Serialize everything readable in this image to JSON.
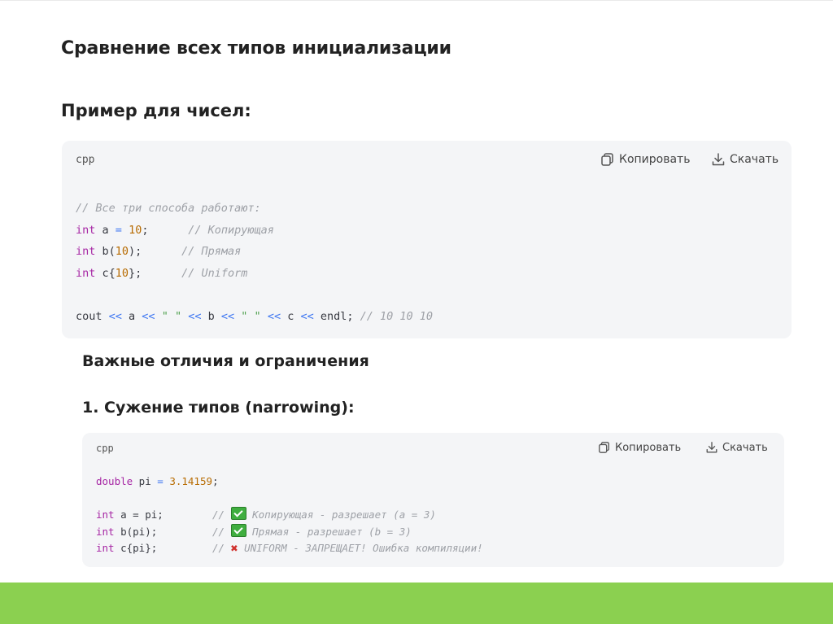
{
  "headings": {
    "main": "Сравнение всех типов инициализации",
    "numbers": "Пример для чисел:",
    "differences": "Важные отличия и ограничения",
    "narrowing": "1. Сужение типов (narrowing):"
  },
  "code_block_1": {
    "language": "cpp",
    "copy_label": "Копировать",
    "download_label": "Скачать",
    "lines": {
      "l1_comment": "// Все три способа работают:",
      "l2_kw": "int",
      "l2_a": " a ",
      "l2_eq": "=",
      "l2_sp": " ",
      "l2_num": "10",
      "l2_end": ";      ",
      "l2_comment": "// Копирующая",
      "l3_kw": "int",
      "l3_a": " b(",
      "l3_num": "10",
      "l3_end": ");      ",
      "l3_comment": "// Прямая",
      "l4_kw": "int",
      "l4_a": " c{",
      "l4_num": "10",
      "l4_end": "};      ",
      "l4_comment": "// Uniform",
      "l6_cout": "cout ",
      "l6_op1": "<<",
      "l6_a": " a ",
      "l6_op2": "<<",
      "l6_sp1": " ",
      "l6_str1": "\" \"",
      "l6_sp2": " ",
      "l6_op3": "<<",
      "l6_b": " b ",
      "l6_op4": "<<",
      "l6_sp3": " ",
      "l6_str2": "\" \"",
      "l6_sp4": " ",
      "l6_op5": "<<",
      "l6_c": " c ",
      "l6_op6": "<<",
      "l6_endl": " endl; ",
      "l6_comment": "// 10 10 10"
    }
  },
  "code_block_2": {
    "language": "cpp",
    "copy_label": "Копировать",
    "download_label": "Скачать",
    "lines": {
      "l1_kw": "double",
      "l1_pi": " pi ",
      "l1_eq": "=",
      "l1_sp": " ",
      "l1_num": "3.14159",
      "l1_end": ";",
      "l3_kw": "int",
      "l3_rest": " a = pi;        ",
      "l3_c1": "// ",
      "l3_c2": " Копирующая - разрешает (a = 3)",
      "l4_kw": "int",
      "l4_rest": " b(pi);         ",
      "l4_c1": "// ",
      "l4_c2": " Прямая - разрешает (b = 3)",
      "l5_kw": "int",
      "l5_rest": " c{pi};         ",
      "l5_c1": "// ",
      "l5_c2": " UNIFORM - ЗАПРЕЩАЕТ! Ошибка компиляции!"
    },
    "icons": [
      "check-icon",
      "check-icon",
      "cross-icon"
    ]
  },
  "colors": {
    "footer_bar": "#8bd050",
    "code_bg": "#f4f5f7",
    "keyword": "#a626a4",
    "number": "#b76b01",
    "comment": "#9ea1a7"
  }
}
